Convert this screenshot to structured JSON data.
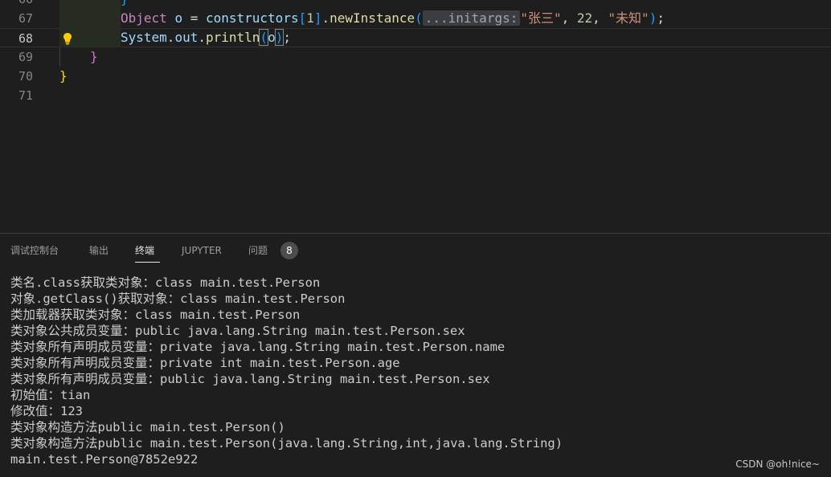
{
  "editor": {
    "lines": [
      {
        "no": "66",
        "text": "}"
      },
      {
        "no": "67",
        "text": "Object o = constructors[1].newInstance(...initargs: \"张三\", 22, \"未知\");"
      },
      {
        "no": "68",
        "text": "System.out.println(o);"
      },
      {
        "no": "69",
        "text": "}"
      },
      {
        "no": "70",
        "text": "}"
      },
      {
        "no": "71",
        "text": ""
      }
    ],
    "line67": {
      "type": "Object",
      "var": "o",
      "op": " = ",
      "recv": "constructors",
      "idx": "1",
      "method": "newInstance",
      "hint": "...initargs:",
      "arg1": "\"张三\"",
      "arg2": "22",
      "arg3": "\"未知\""
    },
    "line68": {
      "cls": "System",
      "field": "out",
      "method": "println",
      "arg": "o"
    },
    "current_line": "68"
  },
  "panel": {
    "tabs": [
      "调试控制台",
      "输出",
      "终端",
      "JUPYTER",
      "问题"
    ],
    "active_tab": "终端",
    "problems_count": "8"
  },
  "terminal": {
    "lines": [
      "类名.class获取类对象：class main.test.Person",
      "对象.getClass()获取对象：class main.test.Person",
      "类加载器获取类对象：class main.test.Person",
      "类对象公共成员变量：public java.lang.String main.test.Person.sex",
      "类对象所有声明成员变量：private java.lang.String main.test.Person.name",
      "类对象所有声明成员变量：private int main.test.Person.age",
      "类对象所有声明成员变量：public java.lang.String main.test.Person.sex",
      "初始值：tian",
      "修改值：123",
      "类对象构造方法public main.test.Person()",
      "类对象构造方法public main.test.Person(java.lang.String,int,java.lang.String)",
      "main.test.Person@7852e922"
    ]
  },
  "watermark": "CSDN @oh!nice~"
}
